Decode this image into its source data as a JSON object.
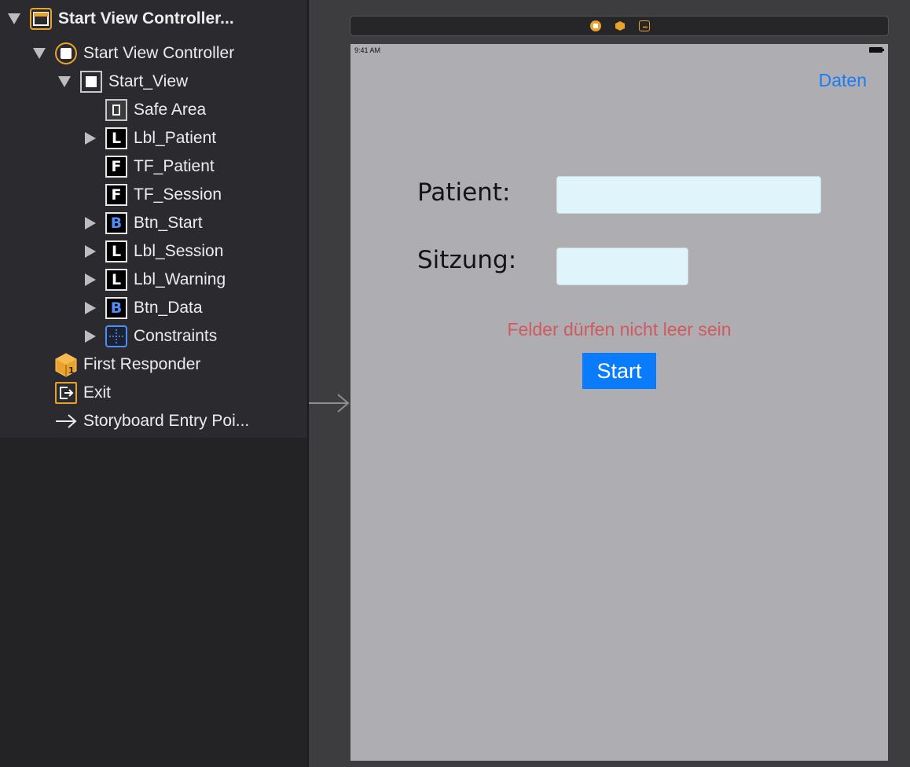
{
  "outline": {
    "scene_title": "Start View Controller...",
    "items": [
      {
        "label": "Start View Controller"
      },
      {
        "label": "Start_View"
      },
      {
        "label": "Safe Area"
      },
      {
        "label": "Lbl_Patient",
        "glyph": "L"
      },
      {
        "label": "TF_Patient",
        "glyph": "F"
      },
      {
        "label": "TF_Session",
        "glyph": "F"
      },
      {
        "label": "Btn_Start",
        "glyph": "B"
      },
      {
        "label": "Lbl_Session",
        "glyph": "L"
      },
      {
        "label": "Lbl_Warning",
        "glyph": "L"
      },
      {
        "label": "Btn_Data",
        "glyph": "B"
      },
      {
        "label": "Constraints"
      },
      {
        "label": "First Responder"
      },
      {
        "label": "Exit"
      },
      {
        "label": "Storyboard Entry Poi..."
      }
    ]
  },
  "device": {
    "status_time": "9:41 AM",
    "nav_button": "Daten",
    "patient_label": "Patient:",
    "session_label": "Sitzung:",
    "patient_value": "",
    "session_value": "",
    "warning": "Felder dürfen nicht leer sein",
    "start_button": "Start"
  },
  "colors": {
    "accent": "#0a7cfb",
    "warning": "#d05a5e",
    "field_bg": "#dff5fb",
    "scene_orange": "#e9a22b",
    "device_bg": "#aeadb2"
  }
}
